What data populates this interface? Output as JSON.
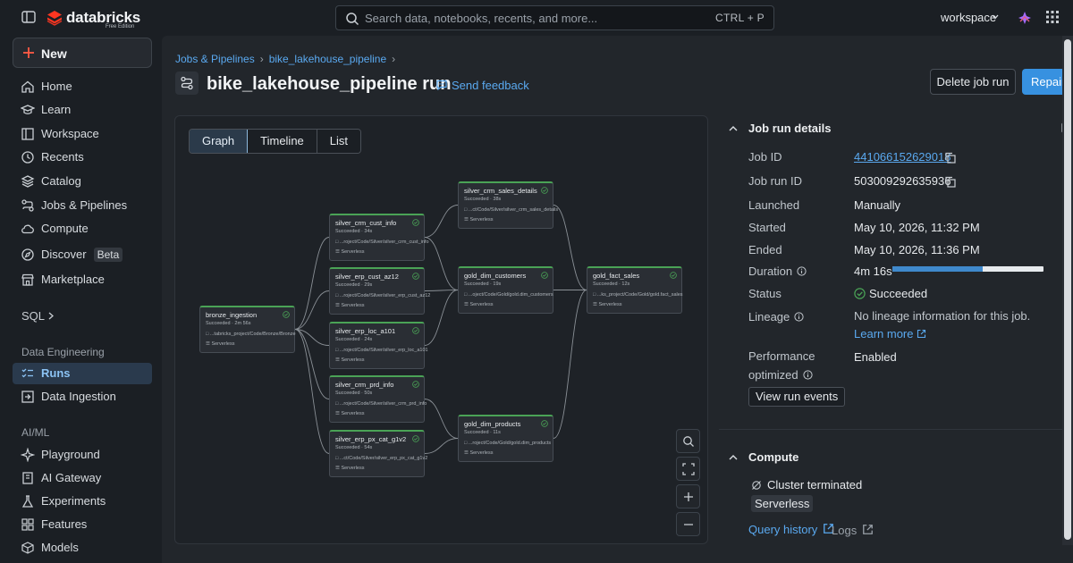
{
  "topbar": {
    "logo_text": "databricks",
    "logo_sub": "Free Edition",
    "search_placeholder": "Search data, notebooks, recents, and more...",
    "search_shortcut": "CTRL + P",
    "workspace_label": "workspace"
  },
  "sidebar": {
    "new_label": "New",
    "items": [
      {
        "label": "Home",
        "icon": "home-icon"
      },
      {
        "label": "Learn",
        "icon": "learn-icon"
      },
      {
        "label": "Workspace",
        "icon": "workspace-icon"
      },
      {
        "label": "Recents",
        "icon": "clock-icon"
      },
      {
        "label": "Catalog",
        "icon": "catalog-icon"
      },
      {
        "label": "Jobs & Pipelines",
        "icon": "jobs-icon"
      },
      {
        "label": "Compute",
        "icon": "cloud-icon"
      },
      {
        "label": "Discover",
        "icon": "discover-icon",
        "badge": "Beta"
      },
      {
        "label": "Marketplace",
        "icon": "marketplace-icon"
      }
    ],
    "sql_label": "SQL",
    "data_engineering_header": "Data Engineering",
    "de_items": [
      {
        "label": "Runs",
        "icon": "runs-icon",
        "active": true
      },
      {
        "label": "Data Ingestion",
        "icon": "ingestion-icon"
      }
    ],
    "aiml_header": "AI/ML",
    "ai_items": [
      {
        "label": "Playground",
        "icon": "playground-icon"
      },
      {
        "label": "AI Gateway",
        "icon": "gateway-icon"
      },
      {
        "label": "Experiments",
        "icon": "experiments-icon"
      },
      {
        "label": "Features",
        "icon": "features-icon"
      },
      {
        "label": "Models",
        "icon": "models-icon"
      }
    ]
  },
  "page": {
    "breadcrumb": [
      "Jobs & Pipelines",
      "bike_lakehouse_pipeline"
    ],
    "title": "bike_lakehouse_pipeline run",
    "feedback": "Send feedback",
    "delete_button": "Delete job run",
    "repair_button": "Repair run"
  },
  "graph": {
    "views": [
      "Graph",
      "Timeline",
      "List"
    ],
    "active_view": "Graph",
    "compute": "Serverless",
    "nodes": [
      {
        "name": "bronze_ingestion",
        "status": "Succeeded",
        "duration": "2m 56s",
        "path": "...tabricks_project/Code/Bronze/Bronze"
      },
      {
        "name": "silver_crm_cust_info",
        "status": "Succeeded",
        "duration": "34s",
        "path": "...roject/Code/Silver/silver_crm_cust_info"
      },
      {
        "name": "silver_erp_cust_az12",
        "status": "Succeeded",
        "duration": "29s",
        "path": "...roject/Code/Silver/silver_erp_cust_az12"
      },
      {
        "name": "silver_erp_loc_a101",
        "status": "Succeeded",
        "duration": "24s",
        "path": "...roject/Code/Silver/silver_erp_loc_a101"
      },
      {
        "name": "silver_crm_prd_info",
        "status": "Succeeded",
        "duration": "50s",
        "path": "...roject/Code/Silver/silver_crm_prd_info"
      },
      {
        "name": "silver_erp_px_cat_g1v2",
        "status": "Succeeded",
        "duration": "54s",
        "path": "...ct/Code/Silver/silver_erp_px_cat_g1v2"
      },
      {
        "name": "silver_crm_sales_details",
        "status": "Succeeded",
        "duration": "38s",
        "path": "...ct/Code/Silver/silver_crm_sales_details"
      },
      {
        "name": "gold_dim_customers",
        "status": "Succeeded",
        "duration": "19s",
        "path": "...oject/Code/Gold/gold.dim_customers"
      },
      {
        "name": "gold_dim_products",
        "status": "Succeeded",
        "duration": "11s",
        "path": "...roject/Code/Gold/gold.dim_products"
      },
      {
        "name": "gold_fact_sales",
        "status": "Succeeded",
        "duration": "12s",
        "path": "...ks_project/Code/Gold/gold.fact_sales"
      }
    ]
  },
  "details": {
    "header": "Job run details",
    "job_id_label": "Job ID",
    "job_id": "441066152629018",
    "job_run_id_label": "Job run ID",
    "job_run_id": "503009292635936",
    "launched_label": "Launched",
    "launched": "Manually",
    "started_label": "Started",
    "started": "May 10, 2026, 11:32 PM",
    "ended_label": "Ended",
    "ended": "May 10, 2026, 11:36 PM",
    "duration_label": "Duration",
    "duration": "4m 16s",
    "duration_fraction": 0.6,
    "status_label": "Status",
    "status": "Succeeded",
    "lineage_label": "Lineage",
    "lineage": "No lineage information for this job.",
    "learn_more": "Learn more",
    "performance_label_1": "Performance",
    "performance_label_2": "optimized",
    "performance": "Enabled",
    "view_events": "View run events"
  },
  "compute": {
    "header": "Compute",
    "cluster": "Cluster terminated",
    "type": "Serverless",
    "query_history": "Query history",
    "logs": "Logs"
  },
  "colors": {
    "accent": "#3791e0",
    "link": "#5aa9f0",
    "success": "#4aa356",
    "brand": "#ff3621"
  }
}
